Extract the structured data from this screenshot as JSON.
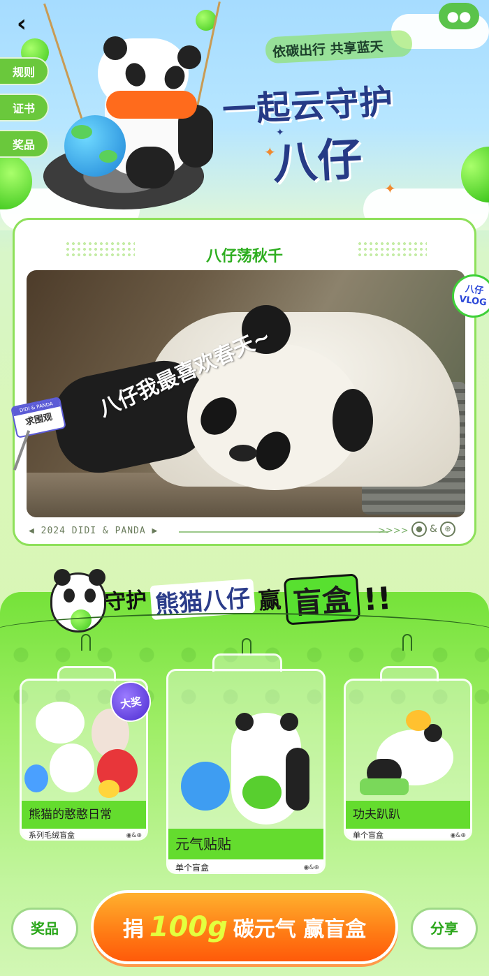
{
  "header": {
    "back_icon": "chevron-left-icon",
    "share_icon": "wechat-icon",
    "slogan": "依碳出行 共享蓝天",
    "title_line1": "一起云守护",
    "title_line2": "八仔",
    "side_tabs": [
      {
        "label": "规则"
      },
      {
        "label": "证书"
      },
      {
        "label": "奖品"
      }
    ]
  },
  "video_card": {
    "title": "八仔荡秋千",
    "caption": "八仔我最喜欢春天~",
    "badge": {
      "line1": "八仔",
      "line2": "VLOG"
    },
    "sign": {
      "top": "DIDI & PANDA",
      "main": "求围观"
    },
    "footer_text": "◀ 2024 DIDI & PANDA ▶",
    "footer_arrows": ">>>>",
    "footer_amp": "&"
  },
  "blindbox_section": {
    "title": {
      "a": "守护",
      "b": "熊猫八仔",
      "c": "赢",
      "d": "盲盒",
      "e": "!!"
    },
    "items": [
      {
        "name": "熊猫的憨憨日常",
        "sub": "系列毛绒盲盒",
        "badge": "大奖"
      },
      {
        "name": "元气贴贴",
        "sub": "单个盲盒"
      },
      {
        "name": "功夫趴趴",
        "sub": "单个盲盒"
      }
    ],
    "icons_amp": "&"
  },
  "bottom_bar": {
    "left_button": "奖品",
    "main_button": {
      "a": "捐",
      "b": "100g",
      "c": "碳元气 赢盲盒"
    },
    "right_button": "分享"
  },
  "colors": {
    "brand_green": "#64dc2e",
    "title_navy": "#263a86",
    "cta_orange": "#ff7a14"
  }
}
